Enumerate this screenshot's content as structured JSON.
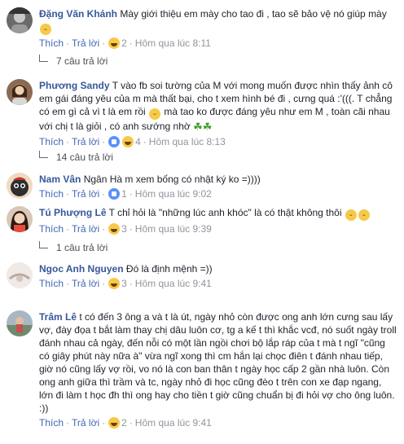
{
  "comments": [
    {
      "author": "Đặng Văn Khánh",
      "text": "Mày giới thiệu em mày cho tao đi , tao sẽ bảo vệ nó giúp mày",
      "like": "Thích",
      "reply": "Trả lời",
      "reaction_count": "2",
      "time": "Hôm qua lúc 8:11",
      "replies": "7 câu trả lời"
    },
    {
      "author": "Phương Sandy",
      "text_part1": "T vào fb soi tường của M với mong muốn được nhìn thấy ảnh cô em gái đáng yêu của m mà thất bại, cho t xem hình bé đi , cưng quá :'(((. T chẳng có em gì cả vì t là em rồi",
      "text_part2": "mà tao ko được đáng yêu như em M , toàn cãi nhau với chị t là giỏi , có anh sướng nhờ",
      "like": "Thích",
      "reply": "Trả lời",
      "reaction_count": "4",
      "time": "Hôm qua lúc 8:13",
      "replies": "14 câu trả lời"
    },
    {
      "author": "Nam Vân",
      "text": "Ngân Hà m xem bống có nhật ký ko =))))",
      "like": "Thích",
      "reply": "Trả lời",
      "reaction_count": "1",
      "time": "Hôm qua lúc 9:02"
    },
    {
      "author": "Tú Phượng Lê",
      "text": "T chỉ hỏi là \"những lúc anh khóc\" là có thật không thôi",
      "like": "Thích",
      "reply": "Trả lời",
      "reaction_count": "3",
      "time": "Hôm qua lúc 9:39",
      "replies": "1 câu trả lời"
    },
    {
      "author": "Ngoc Anh Nguyen",
      "text": "Đó là định mệnh =))",
      "like": "Thích",
      "reply": "Trả lời",
      "reaction_count": "3",
      "time": "Hôm qua lúc 9:41"
    },
    {
      "author": "Trâm Lê",
      "text": "t có đến 3 ông a và t là út, ngày nhỏ còn được ong anh lớn cưng sau lấy vợ, đày đọa t bắt làm thay chị dâu luôn cơ, tg a kế t thì khắc vcđ, nó suốt ngày troll đánh nhau cả ngày, đến nỗi có một lần ngồi chơi bộ lắp ráp của t mà t ngĩ \"cũng có giây phút này nữa à\" vừa ngĩ xong thì cm hắn lại chọc điên t đánh nhau tiếp, giờ nó cũng lấy vợ rồi, vo nó là con ban thân t ngày học cấp 2 gần nhà luôn. Còn ong anh giữa thì trầm và tc, ngày nhỏ đi học cũng đèo t trên con xe đạp ngang, lớn đi làm t học đh thì ong hay cho tiền t giờ cũng chuẩn bị đi hỏi vợ cho ông luôn. :))",
      "like": "Thích",
      "reply": "Trả lời",
      "reaction_count": "2",
      "time": "Hôm qua lúc 9:41"
    }
  ],
  "colors": {
    "author": "#365899",
    "link": "#4267b2",
    "meta": "#90949c",
    "text": "#1d2129"
  }
}
